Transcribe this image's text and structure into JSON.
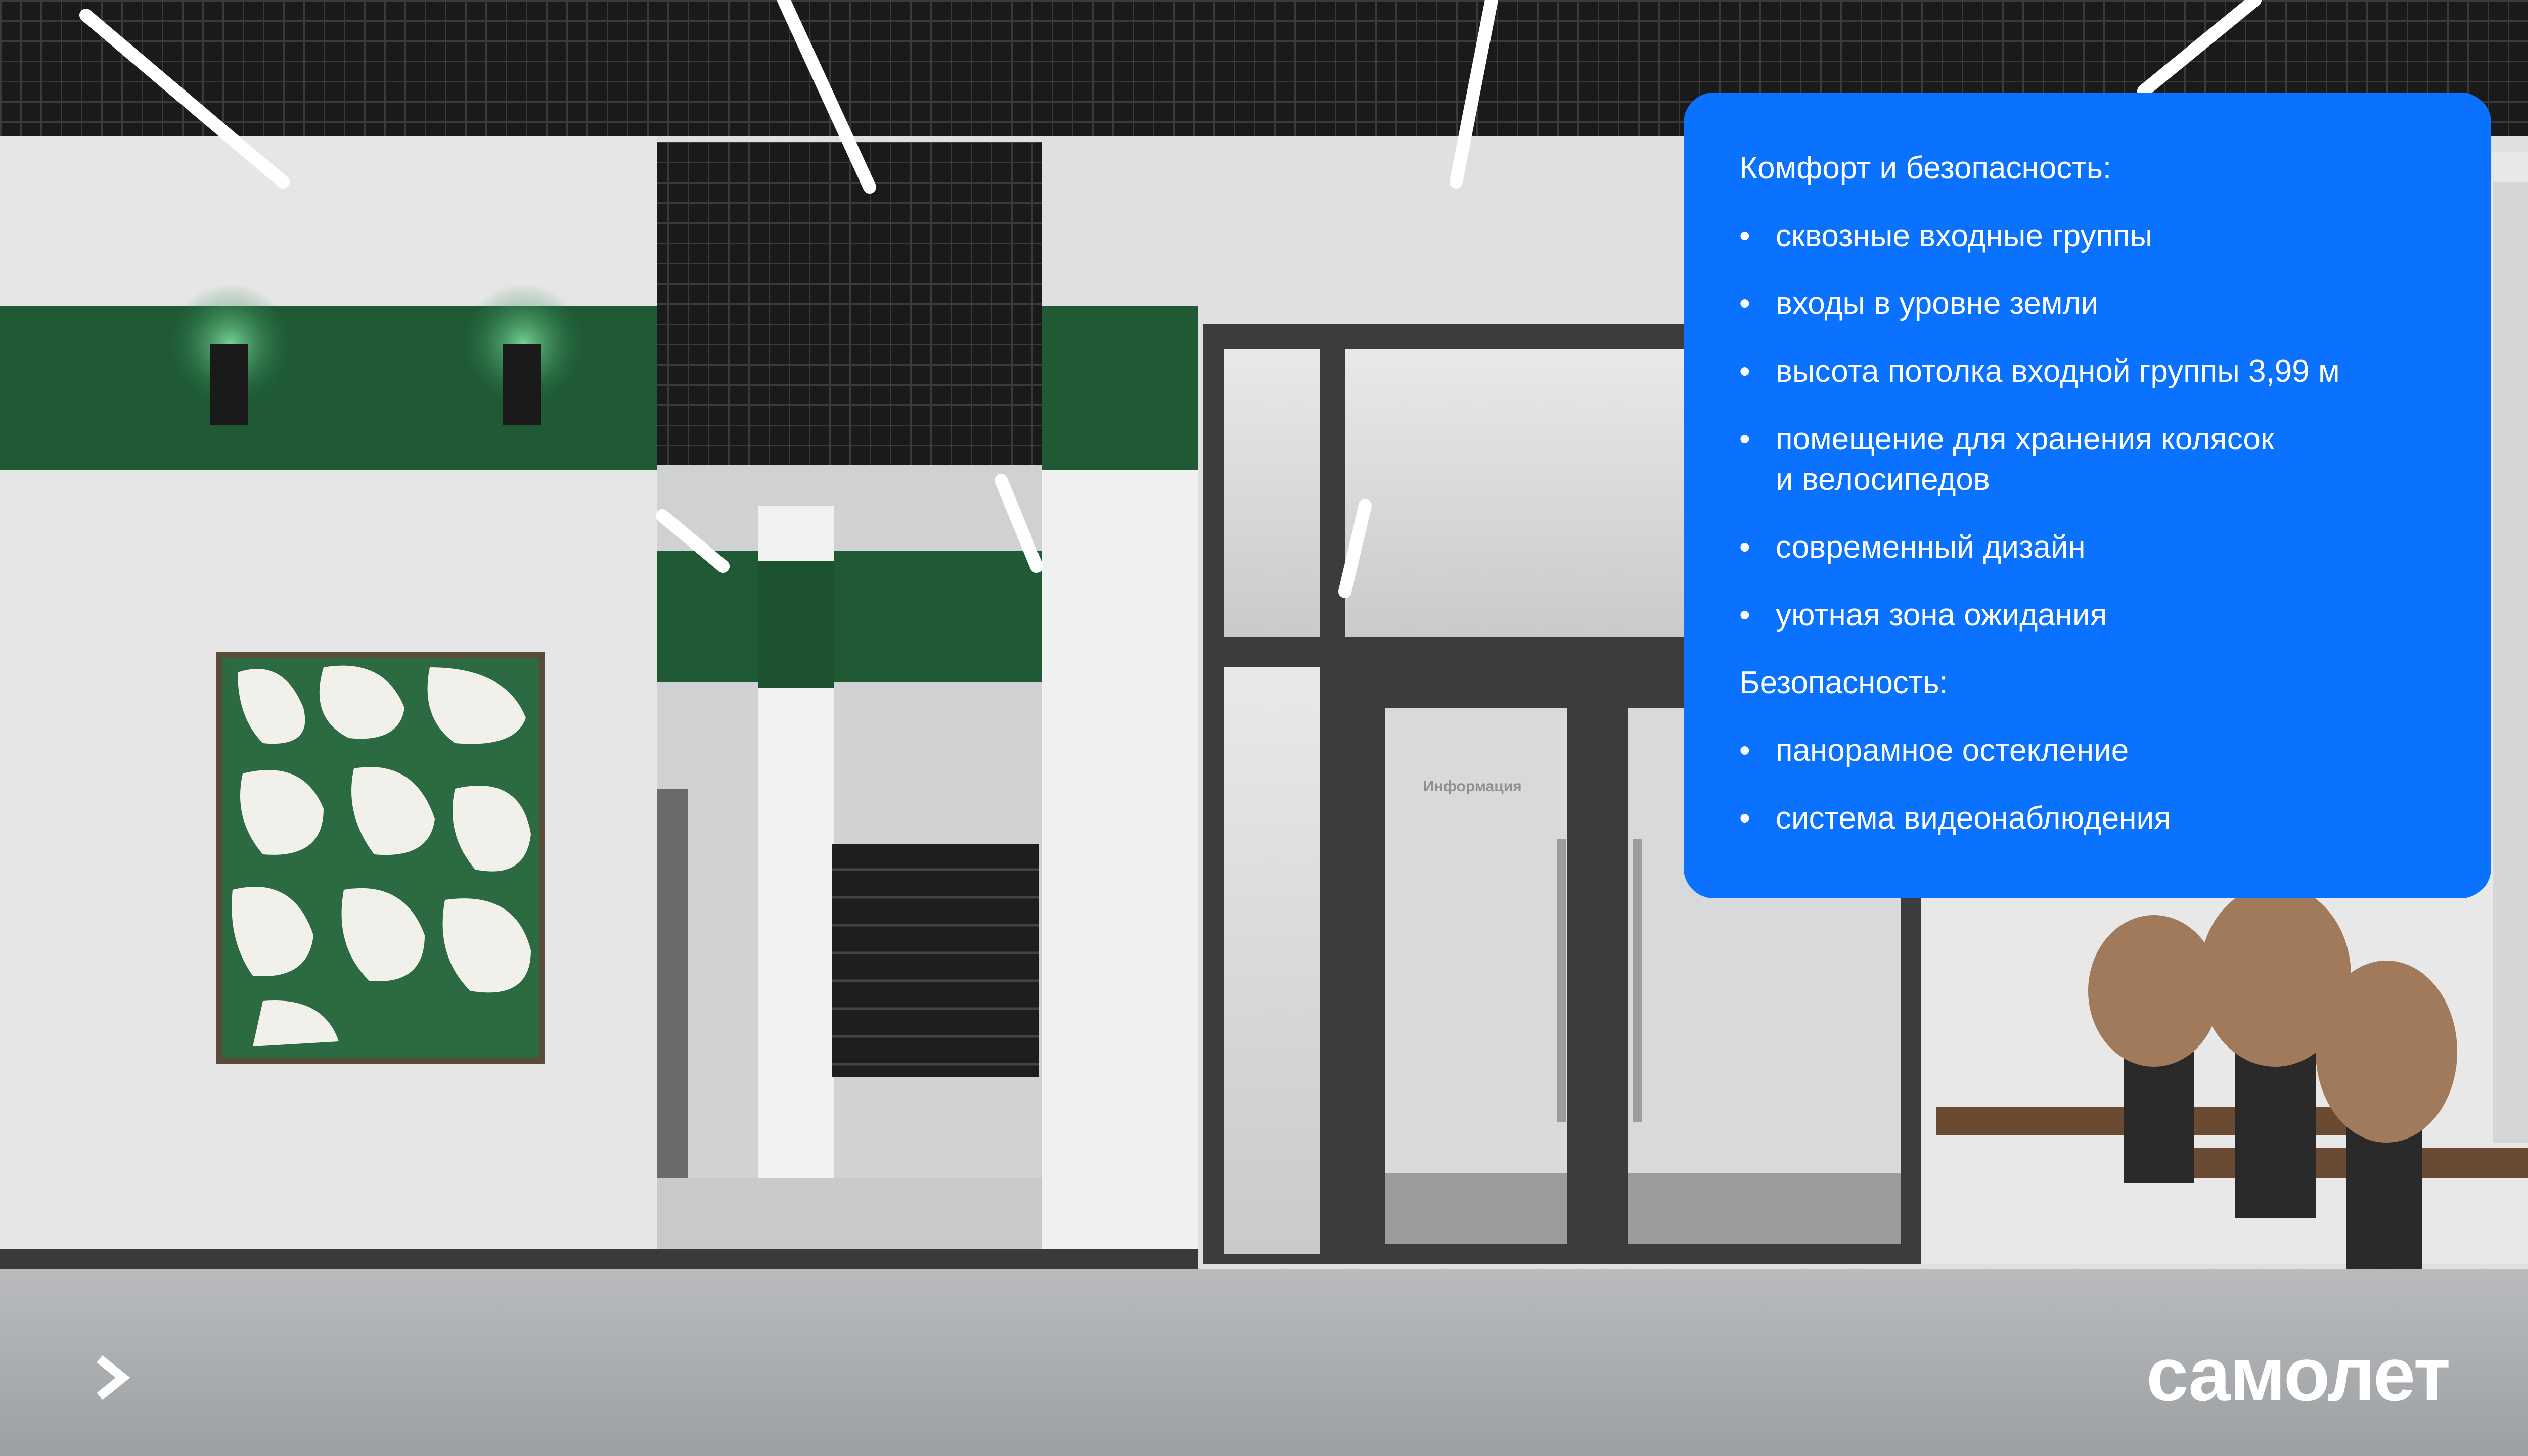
{
  "card": {
    "heading_1": "Комфорт и безопасность:",
    "list_1": [
      "сквозные входные группы",
      "входы в уровне земли",
      "высота потолка входной группы 3,99 м",
      "помещение для хранения колясок\nи велосипедов",
      "современный дизайн",
      "уютная зона ожидания"
    ],
    "heading_2": "Безопасность:",
    "list_2": [
      "панорамное остекление",
      "система видеонаблюдения"
    ],
    "bullet": "•"
  },
  "sign": {
    "info": "Информация"
  },
  "logo": {
    "text": "самолет"
  },
  "colors": {
    "card": "#0a72ff",
    "green": "#1f5a35",
    "text": "#ffffff"
  },
  "icons": {
    "nav": "chevron-right-icon"
  }
}
